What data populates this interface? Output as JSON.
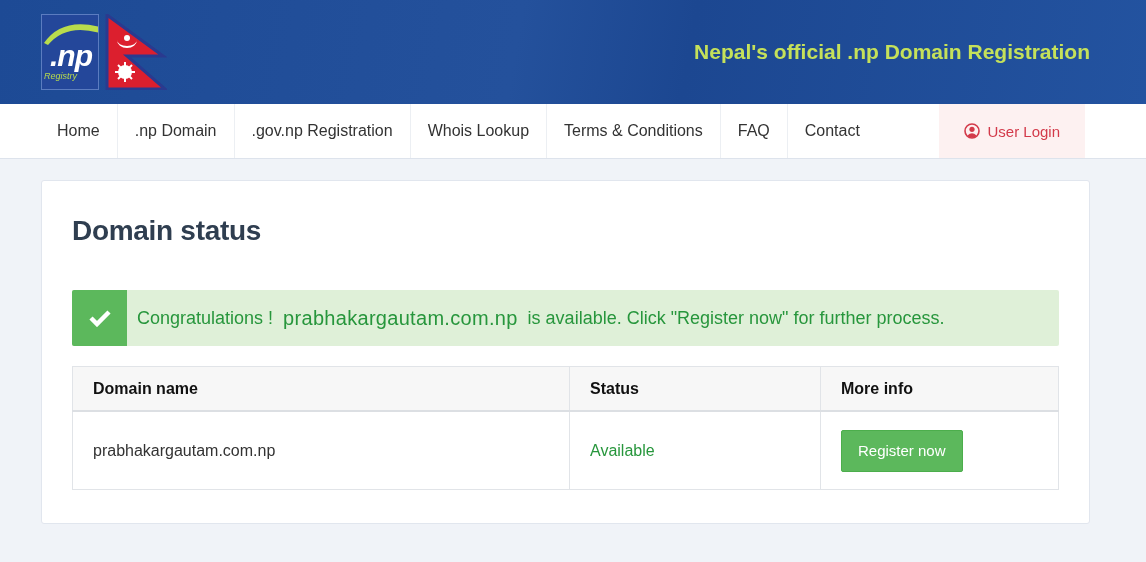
{
  "header": {
    "logo_text": ".np",
    "logo_subtext": "Registry",
    "tagline": "Nepal's official .np Domain Registration"
  },
  "nav": {
    "items": [
      {
        "label": "Home",
        "selected": false
      },
      {
        "label": ".np Domain",
        "selected": false
      },
      {
        "label": ".gov.np Registration",
        "selected": false
      },
      {
        "label": "Whois Lookup",
        "selected": false
      },
      {
        "label": "Terms & Conditions",
        "selected": false
      },
      {
        "label": "FAQ",
        "selected": false
      },
      {
        "label": "Contact",
        "selected": false
      }
    ],
    "login": {
      "label": "User Login"
    }
  },
  "card": {
    "title": "Domain status",
    "alert": {
      "kind": "success",
      "parts": [
        "Congratulations !",
        "prabhakargautam.com.np",
        "is available. Click \"Register now\" for further process."
      ]
    },
    "table": {
      "columns": [
        "Domain name",
        "Status",
        "More info"
      ],
      "rows": [
        {
          "domain": "prabhakargautam.com.np",
          "status": "Available",
          "action": "Register now"
        }
      ]
    }
  }
}
